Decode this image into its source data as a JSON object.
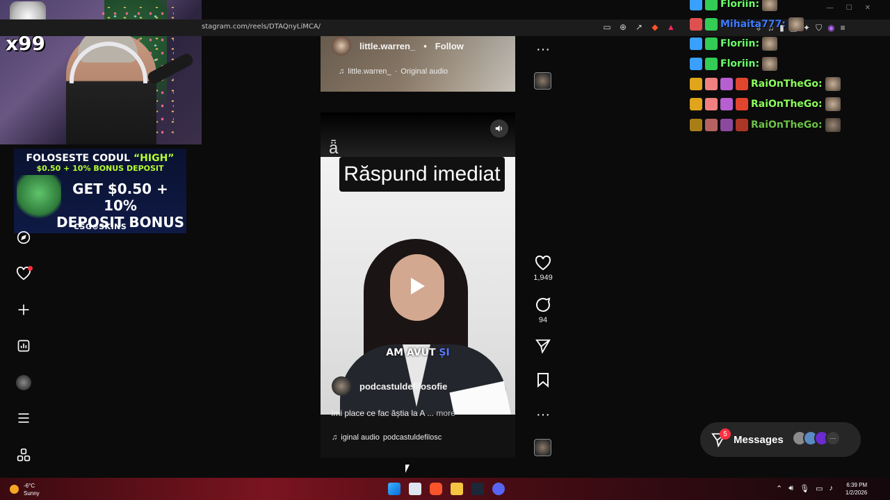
{
  "browser": {
    "url": "stagram.com/reels/DTAQnyLiMCA/",
    "toolbar_icons": [
      "reader-icon",
      "zoom-icon",
      "share-icon",
      "brave-shield-icon",
      "brave-rewards-icon"
    ],
    "extension_icons": [
      "extensions-icon",
      "downloads-icon",
      "music-icon",
      "sidebar-icon",
      "wallet-icon",
      "leo-icon",
      "vpn-icon",
      "brave-icon",
      "menu-icon"
    ]
  },
  "stream": {
    "overlay_badge": "x99",
    "ad": {
      "line1_prefix": "FOLOSESTE CODUL ",
      "line1_code": "“HIGH”",
      "line2": "$0.50 + 10% BONUS DEPOSIT",
      "line3_a": "GET $0.50 + 10%",
      "line3_b": "DEPOSIT BONUS",
      "brand": "CSG⊙SKINS"
    }
  },
  "nav": {
    "items": [
      "explore-icon",
      "notifications-icon",
      "create-icon",
      "dashboard-icon",
      "profile-icon",
      "more-menu-icon",
      "also-from-meta-icon"
    ]
  },
  "reel_prev": {
    "username": "little.warren_",
    "separator": "•",
    "follow": "Follow",
    "audio_user": "little.warren_",
    "audio_sep": "·",
    "audio_label": "Original audio"
  },
  "reel": {
    "caption_overlay": "Răspund imediat",
    "subtitle_a": "AM AVUT ",
    "subtitle_b": "ȘI",
    "username": "podcastuldefilosofie",
    "description": "îmi place ce fac ăștia la A ...",
    "more": "more",
    "audio_label": "iginal audio",
    "audio_user": "podcastuldefilosc"
  },
  "actions": {
    "likes": "1,949",
    "comments": "94"
  },
  "chat": [
    {
      "name": "Floriin:",
      "color": "#6bff6b"
    },
    {
      "name": "Mihaita777:",
      "color": "#3d7bff"
    },
    {
      "name": "Floriin:",
      "color": "#6bff6b"
    },
    {
      "name": "Floriin:",
      "color": "#6bff6b"
    },
    {
      "name": "RaiOnTheGo:",
      "color": "#8cff5a"
    },
    {
      "name": "RaiOnTheGo:",
      "color": "#8cff5a"
    },
    {
      "name": "RaiOnTheGo:",
      "color": "#8cff5a"
    }
  ],
  "messages": {
    "label": "Messages",
    "badge": "5",
    "overflow": "···"
  },
  "taskbar": {
    "temp": "-6°C",
    "weather": "Sunny",
    "time": "6:39 PM",
    "date": "1/2/2026"
  }
}
